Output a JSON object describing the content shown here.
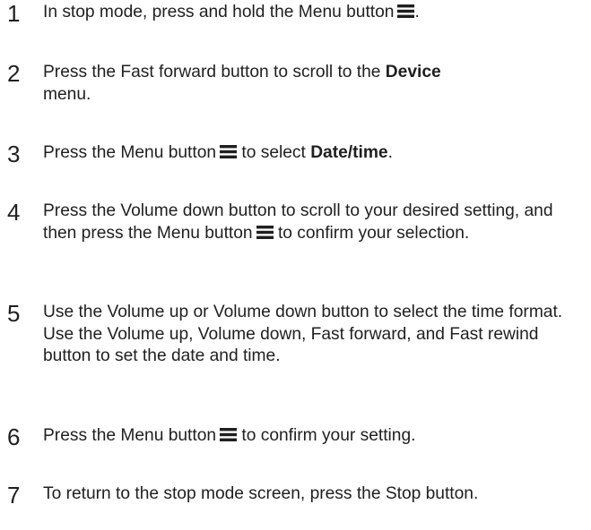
{
  "steps": [
    {
      "number": "1",
      "text_before": "In stop mode, press and hold the Menu button",
      "icon": "menu-icon",
      "text_after": "."
    },
    {
      "number": "2",
      "text_before": "Press the Fast forward button to scroll to the ",
      "bold": "Device",
      "text_after": " menu."
    },
    {
      "number": "3",
      "text_before": "Press the Menu button",
      "icon": "menu-icon",
      "text_middle": " to select ",
      "bold": "Date/time",
      "text_after": "."
    },
    {
      "number": "4",
      "text_before": "Press the Volume down button to scroll to your desired setting, and then press the Menu button",
      "icon": "menu-icon",
      "text_after": " to confirm your selection."
    },
    {
      "number": "5",
      "text": "Use the Volume up or Volume down button to select the time format. Use the Volume up, Volume down, Fast forward, and Fast rewind button to set the date and time."
    },
    {
      "number": "6",
      "text_before": "Press the Menu button",
      "icon": "menu-icon",
      "text_after": " to confirm your setting."
    },
    {
      "number": "7",
      "text": "To return to the stop mode screen, press the Stop button."
    }
  ]
}
